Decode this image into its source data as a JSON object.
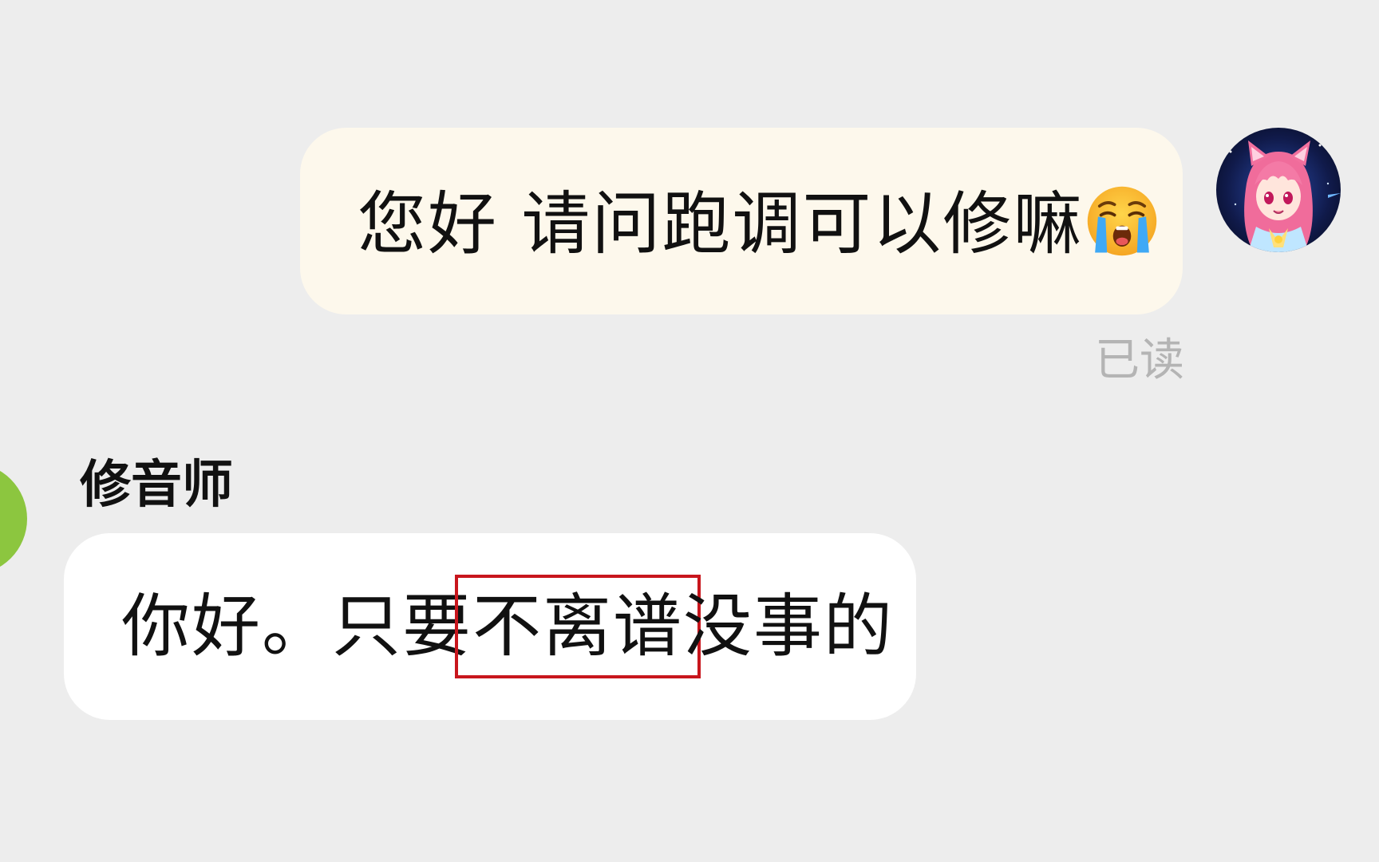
{
  "conversation": {
    "outgoing": {
      "text": "您好 请问跑调可以修嘛",
      "emoji": "loudly-crying-face",
      "status": "已读"
    },
    "incoming": {
      "sender": "修音师",
      "text_before": "你好。只要",
      "text_highlight": "不离谱",
      "text_after": "没事的",
      "highlight_color": "#c8161d"
    }
  },
  "colors": {
    "background": "#ededed",
    "outgoing_bubble": "#fdf8ec",
    "incoming_bubble": "#ffffff",
    "read_status": "#b4b4b4",
    "other_avatar": "#8cc63f"
  }
}
